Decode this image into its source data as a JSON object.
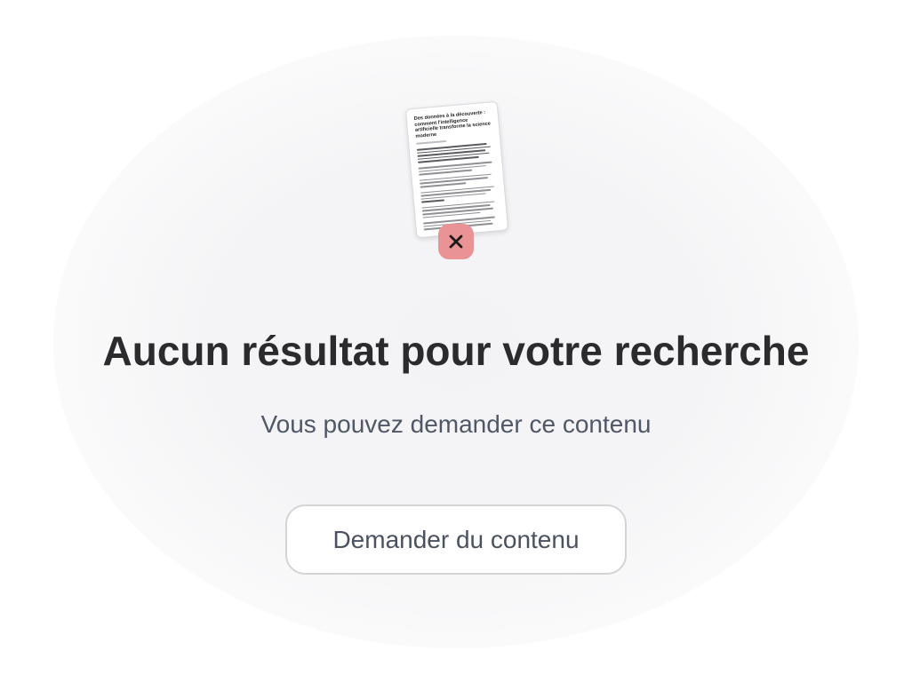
{
  "illustration": {
    "doc_title": "Des données à la découverte : comment l'intelligence artificielle transforme la science moderne",
    "doc_icon": "document-icon",
    "close_icon": "close-icon",
    "close_color": "#e99394"
  },
  "empty_state": {
    "title": "Aucun résultat pour votre recherche",
    "subtitle": "Vous pouvez demander ce contenu",
    "button_label": "Demander du contenu"
  },
  "colors": {
    "title": "#2b2b2d",
    "subtitle": "#505867",
    "button_border": "#d4d4d6",
    "button_text": "#4a5261"
  }
}
